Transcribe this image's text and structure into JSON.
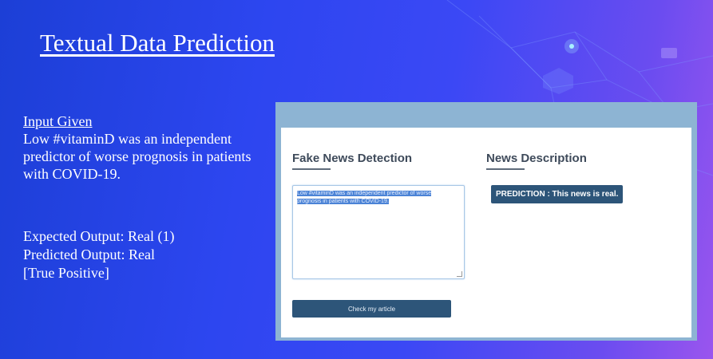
{
  "slide": {
    "title": "Textual Data Prediction",
    "input_heading": "Input Given",
    "input_text": "Low #vitaminD was an independent predictor of worse prognosis in patients with COVID-19.",
    "expected_output": "Expected Output: Real (1)",
    "predicted_output": "Predicted Output: Real",
    "classification": "[True Positive]"
  },
  "app": {
    "left_section_title": "Fake News Detection",
    "right_section_title": "News Description",
    "textarea_value": "Low #vitaminD was an independent predictor of worse prognosis in patients with COVID-19.",
    "check_button_label": "Check my article",
    "prediction_text": "PREDICTION : This news is real.",
    "colors": {
      "topbar": "#8db4d3",
      "button": "#2d5579",
      "selection": "#4b83d6"
    }
  }
}
